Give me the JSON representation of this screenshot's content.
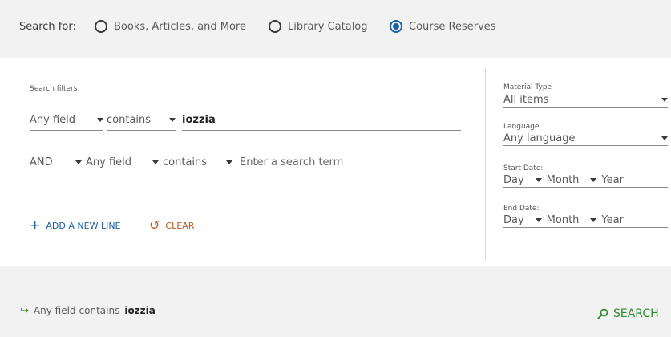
{
  "search_for": {
    "label": "Search for:",
    "options": [
      {
        "label": "Books, Articles, and More",
        "checked": false
      },
      {
        "label": "Library Catalog",
        "checked": false
      },
      {
        "label": "Course Reserves",
        "checked": true
      }
    ]
  },
  "filters": {
    "title": "Search filters",
    "rows": [
      {
        "operator": null,
        "field": "Any field",
        "condition": "contains",
        "term": "iozzia",
        "placeholder": ""
      },
      {
        "operator": "AND",
        "field": "Any field",
        "condition": "contains",
        "term": "",
        "placeholder": "Enter a search term"
      }
    ],
    "add_line": "ADD A NEW LINE",
    "clear": "CLEAR"
  },
  "side": {
    "material_type": {
      "label": "Material Type",
      "value": "All items"
    },
    "language": {
      "label": "Language",
      "value": "Any language"
    },
    "start_date": {
      "label": "Start Date:",
      "day": "Day",
      "month": "Month",
      "year": "Year"
    },
    "end_date": {
      "label": "End Date:",
      "day": "Day",
      "month": "Month",
      "year": "Year"
    }
  },
  "summary": {
    "field": "Any field",
    "condition": "contains",
    "term": "iozzia",
    "search_button": "SEARCH"
  },
  "colors": {
    "accent": "#1a5fa8",
    "clear": "#c0581a",
    "search": "#2e8b2e"
  }
}
